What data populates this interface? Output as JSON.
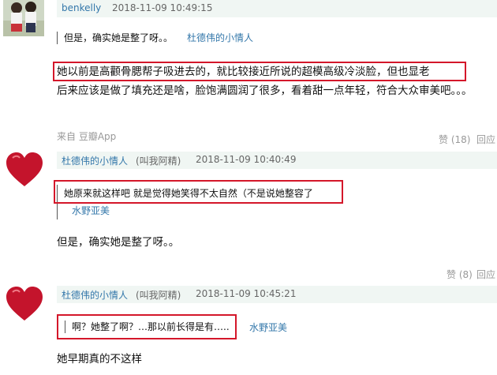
{
  "comments": [
    {
      "user": "benkelly",
      "time": "2018-11-09 10:49:15",
      "quote_text": "但是，确实她是整了呀。。",
      "quote_user": "杜德伟的小情人",
      "body_line1": "她以前是高颧骨腮帮子吸进去的，就比较接近所说的超模高级冷淡脸，但也显老",
      "body_line2": "后来应该是做了填充还是啥，脸饱满圆润了很多，看着甜一点年轻，符合大众审美吧。。。",
      "source": "来自 豆瓣App",
      "like_label": "赞 (18)",
      "reply_label": "回应"
    },
    {
      "user": "杜德伟的小情人",
      "nickname": "(叫我阿精)",
      "time": "2018-11-09 10:40:49",
      "quote_text": "她原来就这样吧 就是觉得她笑得不太自然（不是说她整容了",
      "quote_user": "水野亚美",
      "body": "但是，确实她是整了呀。。",
      "like_label": "赞 (8)",
      "reply_label": "回应"
    },
    {
      "user": "杜德伟的小情人",
      "nickname": "(叫我阿精)",
      "time": "2018-11-09 10:45:21",
      "quote_text": "啊？她整了啊？…那以前长得是有…..",
      "quote_user": "水野亚美",
      "body": "她早期真的不这样"
    }
  ],
  "colors": {
    "link": "#3377aa",
    "highlight_box": "#d4172a",
    "meta_bg": "#f0f6f3"
  },
  "icons": [
    "user-photo-avatar",
    "heart-avatar"
  ]
}
